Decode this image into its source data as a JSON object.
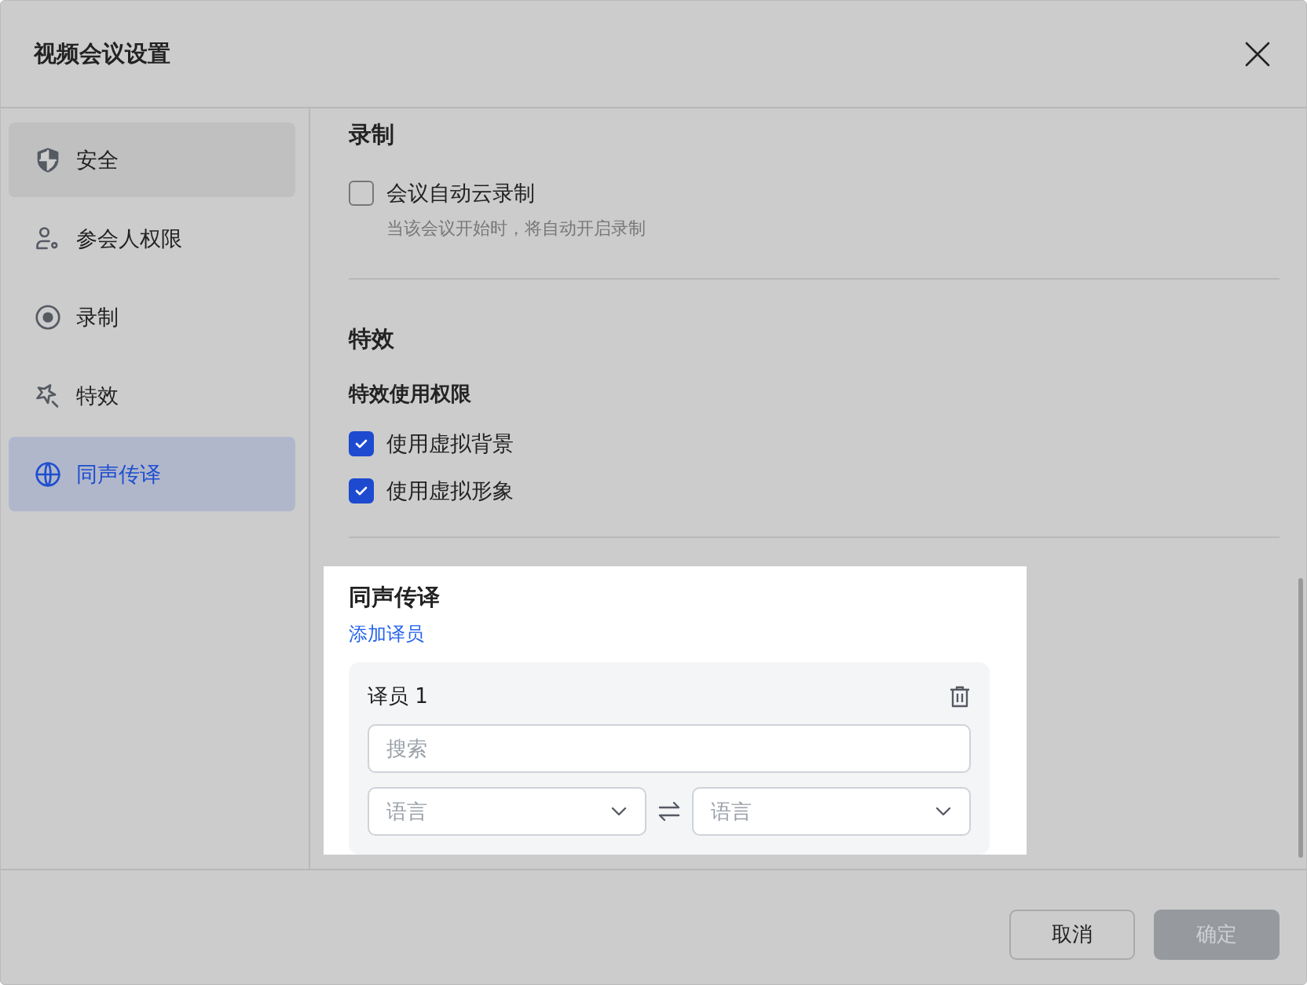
{
  "dialog": {
    "title": "视频会议设置"
  },
  "sidebar": {
    "items": [
      {
        "kind": "shield",
        "label": "安全",
        "selected": false,
        "hovered": true
      },
      {
        "kind": "people",
        "label": "参会人权限",
        "selected": false,
        "hovered": false
      },
      {
        "kind": "record",
        "label": "录制",
        "selected": false,
        "hovered": false
      },
      {
        "kind": "effects",
        "label": "特效",
        "selected": false,
        "hovered": false
      },
      {
        "kind": "globe",
        "label": "同声传译",
        "selected": true,
        "hovered": false
      }
    ]
  },
  "recording": {
    "heading": "录制",
    "option": {
      "label": "会议自动云录制",
      "description": "当该会议开始时，将自动开启录制",
      "checked": false
    }
  },
  "effects": {
    "heading": "特效",
    "subheading": "特效使用权限",
    "options": [
      {
        "label": "使用虚拟背景",
        "checked": true
      },
      {
        "label": "使用虚拟形象",
        "checked": true
      }
    ]
  },
  "interpretation": {
    "heading": "同声传译",
    "add_link": "添加译员",
    "interpreters": [
      {
        "title": "译员 1",
        "search": {
          "placeholder": "搜索"
        },
        "source_language": {
          "placeholder": "语言"
        },
        "target_language": {
          "placeholder": "语言"
        }
      }
    ]
  },
  "footer": {
    "buttons": [
      {
        "label": "取消",
        "kind": "secondary",
        "disabled": false
      },
      {
        "label": "确定",
        "kind": "primary",
        "disabled": true
      }
    ]
  }
}
